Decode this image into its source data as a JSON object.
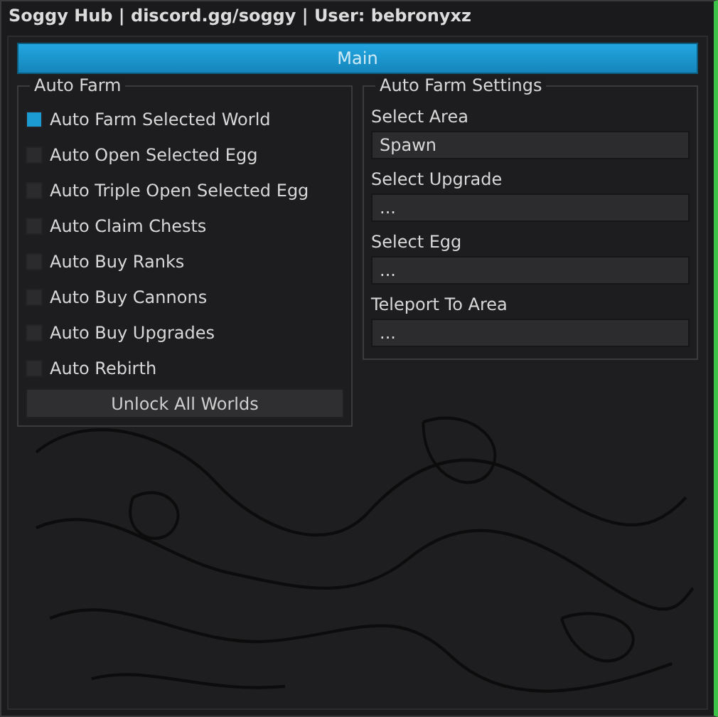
{
  "window": {
    "title": "Soggy Hub | discord.gg/soggy | User: bebronyxz"
  },
  "tabs": [
    {
      "label": "Main",
      "selected": true
    }
  ],
  "auto_farm": {
    "title": "Auto Farm",
    "toggles": [
      {
        "label": "Auto Farm Selected World",
        "checked": true
      },
      {
        "label": "Auto Open Selected Egg",
        "checked": false
      },
      {
        "label": "Auto Triple Open Selected Egg",
        "checked": false
      },
      {
        "label": "Auto Claim Chests",
        "checked": false
      },
      {
        "label": "Auto Buy Ranks",
        "checked": false
      },
      {
        "label": "Auto Buy Cannons",
        "checked": false
      },
      {
        "label": "Auto Buy Upgrades",
        "checked": false
      },
      {
        "label": "Auto Rebirth",
        "checked": false
      }
    ],
    "button": "Unlock All Worlds"
  },
  "settings": {
    "title": "Auto Farm Settings",
    "dropdowns": [
      {
        "label": "Select Area",
        "value": "Spawn"
      },
      {
        "label": "Select Upgrade",
        "value": "..."
      },
      {
        "label": "Select Egg",
        "value": "..."
      },
      {
        "label": "Teleport To Area",
        "value": "..."
      }
    ]
  }
}
